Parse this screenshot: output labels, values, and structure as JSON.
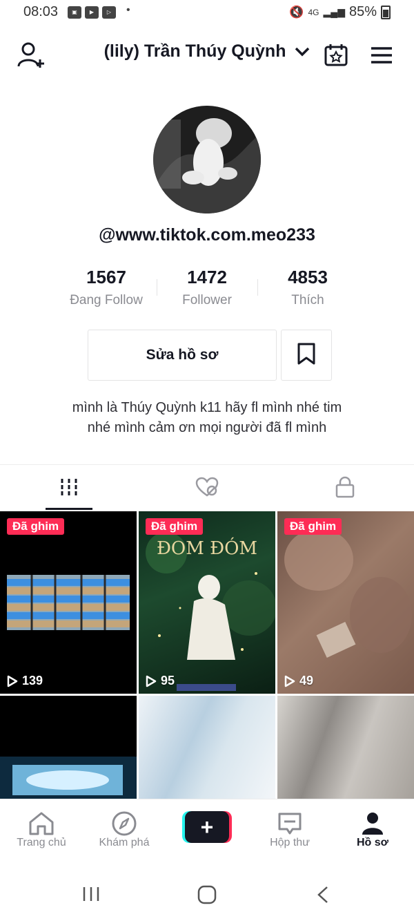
{
  "status_bar": {
    "time": "08:03",
    "battery": "85%",
    "network": "4G",
    "icons": [
      "gallery-icon",
      "youtube-icon",
      "play-icon"
    ]
  },
  "header": {
    "title": "(lily) Trần Thúy Quỳnh"
  },
  "profile": {
    "username": "@www.tiktok.com.meo233",
    "stats": [
      {
        "value": "1567",
        "label": "Đang Follow"
      },
      {
        "value": "1472",
        "label": "Follower"
      },
      {
        "value": "4853",
        "label": "Thích"
      }
    ],
    "edit_label": "Sửa hồ sơ",
    "bio_line1": "mình là Thúy Quỳnh k11 hãy fl mình nhé tim",
    "bio_line2": "nhé mình cảm ơn mọi người đã fl mình"
  },
  "videos": [
    {
      "pinned": "Đã ghim",
      "views": "139"
    },
    {
      "pinned": "Đã ghim",
      "views": "95"
    },
    {
      "pinned": "Đã ghim",
      "views": "49"
    }
  ],
  "nav": {
    "home": "Trang chủ",
    "discover": "Khám phá",
    "inbox": "Hộp thư",
    "profile": "Hồ sơ"
  },
  "colors": {
    "accent": "#fe2c55",
    "cyan": "#25f4ee",
    "text": "#161823",
    "muted": "#8a8b91"
  }
}
